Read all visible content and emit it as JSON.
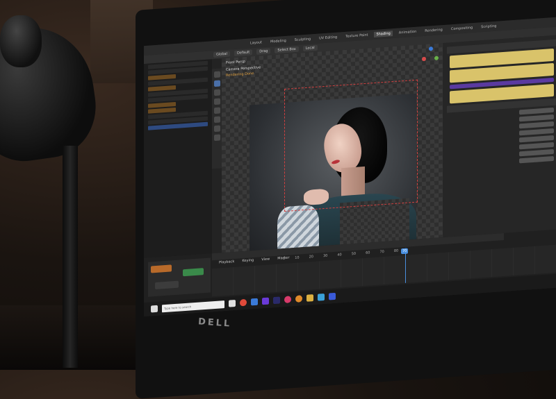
{
  "scene": {
    "description_labels": {
      "monitor_brand": "DELL"
    }
  },
  "app": {
    "menu_tabs": [
      "Layout",
      "Modeling",
      "Sculpting",
      "UV Editing",
      "Texture Paint",
      "Shading",
      "Animation",
      "Rendering",
      "Compositing",
      "Scripting"
    ],
    "active_tab_index": 5,
    "toolbar": [
      "Global",
      "Default",
      "Drag",
      "Select Box",
      "Local"
    ],
    "viewport": {
      "mode": "Front Persp",
      "header": [
        "View",
        "Select",
        "Pivot"
      ],
      "overlay_line1": "Camera Perspective",
      "overlay_line2": "Rendering Done"
    },
    "timeline": {
      "menu": [
        "Playback",
        "Keying",
        "View",
        "Marker"
      ],
      "frame_numbers": [
        "0",
        "10",
        "20",
        "30",
        "40",
        "50",
        "60",
        "70",
        "80"
      ],
      "current_frame": "70"
    },
    "taskbar": {
      "search_placeholder": "Type here to search"
    }
  },
  "colors": {
    "accent": "#4a90e0",
    "yellow_field": "#d9c36a",
    "camera_frame": "#d24040",
    "active_tab": "#4a4a4a"
  }
}
